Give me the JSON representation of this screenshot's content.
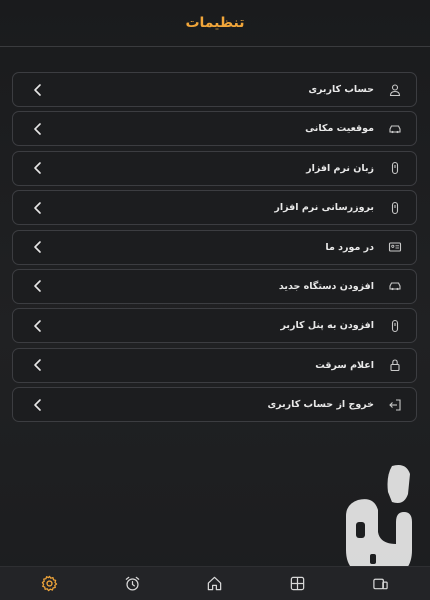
{
  "header": {
    "title": "تنظیمات"
  },
  "menu": {
    "items": [
      {
        "label": "حساب کاربری",
        "icon": "user-icon"
      },
      {
        "label": "موقعیت مکانی",
        "icon": "car-icon"
      },
      {
        "label": "زبان نرم افزار",
        "icon": "device-icon"
      },
      {
        "label": "بروزرسانی نرم افزار",
        "icon": "device-icon"
      },
      {
        "label": "در مورد ما",
        "icon": "id-card-icon"
      },
      {
        "label": "افزودن دستگاه جدید",
        "icon": "car-icon"
      },
      {
        "label": "افزودن به پنل کاربر",
        "icon": "device-icon"
      },
      {
        "label": "اعلام سرقت",
        "icon": "lock-icon"
      },
      {
        "label": "خروج از حساب کاربری",
        "icon": "logout-icon"
      }
    ]
  },
  "bottom_nav": {
    "tabs": [
      {
        "name": "settings",
        "icon": "gear-icon",
        "active": true
      },
      {
        "name": "alarm",
        "icon": "alarm-clock-icon",
        "active": false
      },
      {
        "name": "home",
        "icon": "home-icon",
        "active": false
      },
      {
        "name": "dashboard",
        "icon": "grid-icon",
        "active": false
      },
      {
        "name": "devices",
        "icon": "devices-icon",
        "active": false
      }
    ]
  },
  "colors": {
    "accent": "#f1a63a",
    "background": "#1d1e20",
    "item_border": "#3c3d41",
    "text": "#e9e9e9",
    "icon": "#c9c9c9"
  }
}
